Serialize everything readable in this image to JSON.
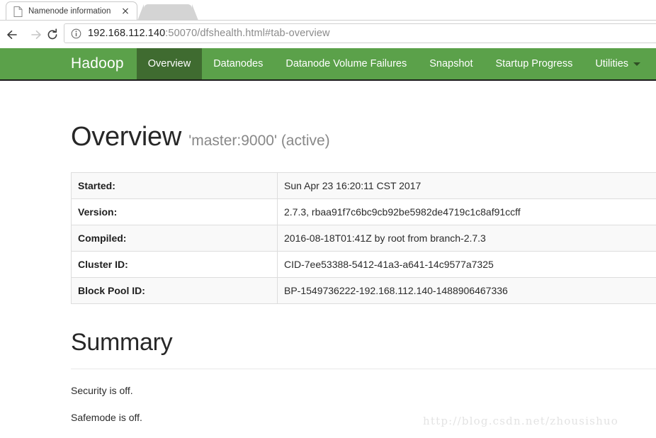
{
  "browser": {
    "tab": {
      "title": "Namenode information",
      "favicon": "page-icon",
      "close_label": "×"
    },
    "toolbar": {
      "back_icon": "back-arrow-icon",
      "forward_icon": "forward-arrow-icon",
      "reload_icon": "reload-icon",
      "info_icon": "site-info-icon",
      "url_host": "192.168.112.140",
      "url_rest": ":50070/dfshealth.html#tab-overview",
      "url_full": "192.168.112.140:50070/dfshealth.html#tab-overview"
    }
  },
  "navbar": {
    "brand": "Hadoop",
    "background_color": "#5ba14a",
    "active_color": "#3f6b30",
    "items": [
      {
        "label": "Overview",
        "active": true
      },
      {
        "label": "Datanodes",
        "active": false
      },
      {
        "label": "Datanode Volume Failures",
        "active": false
      },
      {
        "label": "Snapshot",
        "active": false
      },
      {
        "label": "Startup Progress",
        "active": false
      },
      {
        "label": "Utilities",
        "active": false,
        "has_caret": true
      }
    ]
  },
  "overview": {
    "title": "Overview",
    "subtitle": "'master:9000' (active)",
    "rows": [
      {
        "key": "Started:",
        "value": "Sun Apr 23 16:20:11 CST 2017"
      },
      {
        "key": "Version:",
        "value": "2.7.3, rbaa91f7c6bc9cb92be5982de4719c1c8af91ccff"
      },
      {
        "key": "Compiled:",
        "value": "2016-08-18T01:41Z by root from branch-2.7.3"
      },
      {
        "key": "Cluster ID:",
        "value": "CID-7ee53388-5412-41a3-a641-14c9577a7325"
      },
      {
        "key": "Block Pool ID:",
        "value": "BP-1549736222-192.168.112.140-1488906467336"
      }
    ]
  },
  "summary": {
    "title": "Summary",
    "lines": [
      "Security is off.",
      "Safemode is off."
    ]
  },
  "watermark": "http://blog.csdn.net/zhousishuo"
}
